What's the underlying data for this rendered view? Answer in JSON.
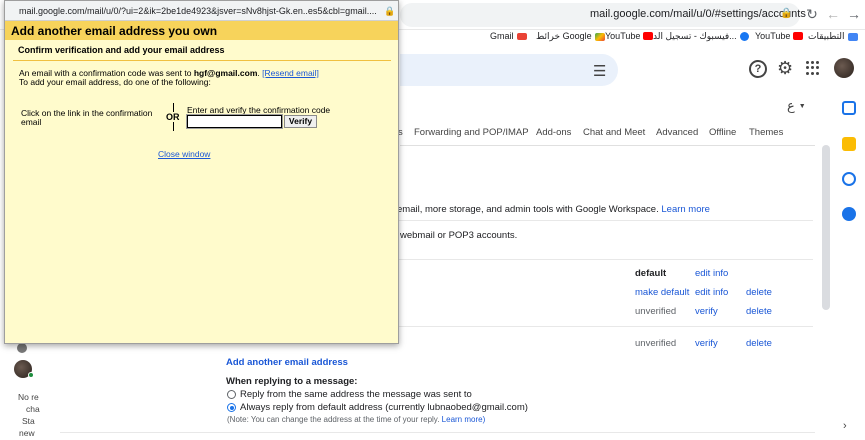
{
  "browser": {
    "url": "mail.google.com/mail/u/0/#settings/accounts",
    "bookmarks": [
      {
        "label": "التطبيقات",
        "color": "#4285f4"
      },
      {
        "label": "YouTube",
        "color": "#ff0000"
      },
      {
        "label": "فيسبوك - تسجيل الد...",
        "color": "#1877f2"
      },
      {
        "label": "YouTube",
        "color": "#ff0000"
      },
      {
        "label": "خرائط Google",
        "color": "#34a853"
      },
      {
        "label": "Gmail",
        "color": "#ea4335"
      }
    ]
  },
  "gmail": {
    "language_selector": "ع",
    "tabs": [
      "s",
      "Forwarding and POP/IMAP",
      "Add-ons",
      "Chat and Meet",
      "Advanced",
      "Offline",
      "Themes"
    ],
    "workspace_text": "email, more storage, and admin tools with Google Workspace.",
    "workspace_link": "Learn more",
    "pop3_text": "webmail or POP3 accounts.",
    "accounts": [
      {
        "status": "default",
        "action1": "edit info",
        "action2": ""
      },
      {
        "status": "make default",
        "action1": "edit info",
        "action2": "delete"
      },
      {
        "status": "unverified",
        "action1": "verify",
        "action2": "delete"
      },
      {
        "status": "unverified",
        "action1": "verify",
        "action2": "delete"
      }
    ],
    "add_email_link": "Add another email address",
    "replying_heading": "When replying to a message:",
    "reply_option1": "Reply from the same address the message was sent to",
    "reply_option2": "Always reply from default address (currently lubnaobed@gmail.com)",
    "reply_note": "(Note: You can change the address at the time of your reply.",
    "reply_note_link": "Learn more)",
    "left_strip": {
      "line1": "No re",
      "line2": "cha",
      "line3": "Sta",
      "line4": "new"
    }
  },
  "popup": {
    "url": "mail.google.com/mail/u/0/?ui=2&ik=2be1de4923&jsver=sNv8hjst-Gk.en..es5&cbl=gmail....",
    "title": "Add another email address you own",
    "subtitle": "Confirm verification and add your email address",
    "sent_prefix": "An email with a confirmation code was sent to",
    "sent_email": "hgf@gmail.com",
    "sent_dot": ".",
    "resend_link": "[Resend email]",
    "instructions": "To add your email address, do one of the following:",
    "option_link_line1": "Click on the link in the confirmation",
    "option_link_line2": "email",
    "or_label": "OR",
    "code_label": "Enter and verify the confirmation code",
    "code_value": "",
    "verify_label": "Verify",
    "close_label": "Close window"
  },
  "colors": {
    "accent": "#1a57d6",
    "popup_bg": "#fffbcc",
    "popup_header": "#f7d35b"
  }
}
